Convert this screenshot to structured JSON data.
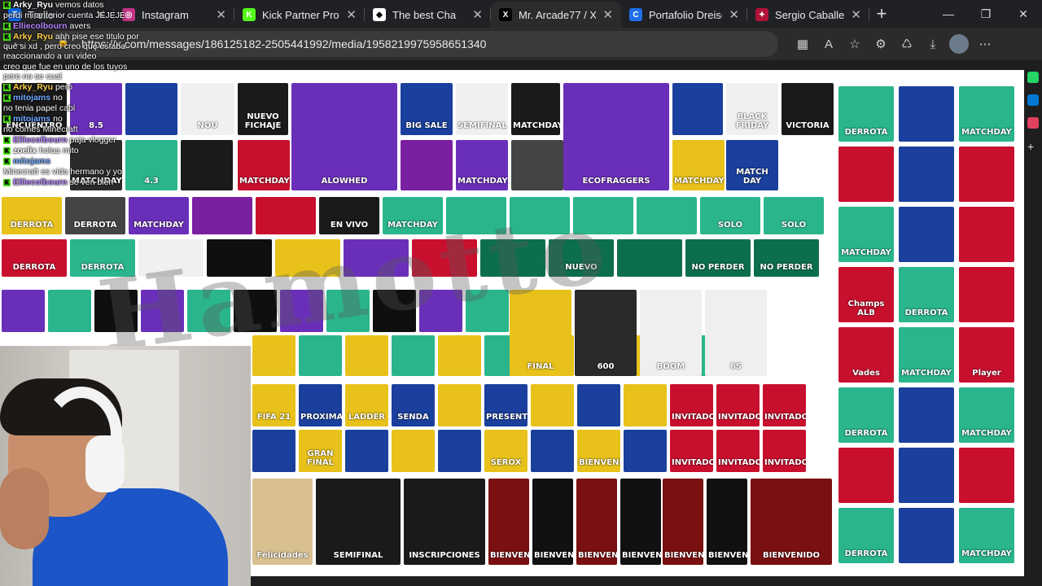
{
  "tabs": [
    {
      "title": "Trello",
      "x": false,
      "color": "#0c66e4",
      "glyph": "T",
      "active": false
    },
    {
      "title": "Instagram",
      "color": "#c13584",
      "glyph": "◎",
      "active": false
    },
    {
      "title": "Kick Partner Progr",
      "color": "#53fc18",
      "glyph": "K",
      "active": false
    },
    {
      "title": "The best Cha",
      "color": "#ffffff",
      "glyph": "◆",
      "active": false
    },
    {
      "title": "Mr. Arcade77 / X",
      "color": "#000000",
      "glyph": "X",
      "active": true
    },
    {
      "title": "Portafolio Dreisen",
      "color": "#1e6fe8",
      "glyph": "C",
      "active": false
    },
    {
      "title": "Sergio Caballero |",
      "color": "#b0123a",
      "glyph": "✦",
      "active": false
    }
  ],
  "window_controls": {
    "minimize": "—",
    "restore": "❐",
    "close": "✕"
  },
  "address_bar": {
    "url": "https://x.com/messages/186125182-2505441992/media/1958219975958651340"
  },
  "chat": [
    {
      "user": "Arky_Ryu",
      "text": "vemos datos",
      "color": "#ffffff"
    },
    {
      "user": "",
      "text": "perdi mi anterior cuenta JEJEJE",
      "color": "#ffffff"
    },
    {
      "user": "Elliecolbourn",
      "text": "avers",
      "color": "#b583ff"
    },
    {
      "user": "Arky_Ryu",
      "text": "ahh pise ese titulo por qué si xd , pero creo que estaba reaccionando a un video",
      "color": "#ffd24a"
    },
    {
      "user": "",
      "text": "creo que fue en uno de los tuyos pero no se cual",
      "color": "#ffffff"
    },
    {
      "user": "Arky_Ryu",
      "text": "pero",
      "color": "#ffd24a"
    },
    {
      "user": "mitojams",
      "text": "no",
      "color": "#6fa8ff"
    },
    {
      "user": "",
      "text": "no tenia papel cabl",
      "color": "#ffffff"
    },
    {
      "user": "mitojams",
      "text": "no",
      "color": "#6fa8ff"
    },
    {
      "user": "",
      "text": "no comes Minecraft",
      "color": "#ffffff"
    },
    {
      "user": "Elliecolbourn",
      "text": "paja vlogger",
      "color": "#b583ff"
    },
    {
      "user": "zoelix",
      "text": "holaa mito",
      "color": "#ffffff"
    },
    {
      "user": "mitojams",
      "text": "",
      "color": "#6fa8ff"
    },
    {
      "user": "",
      "text": "Minecraft es vida hermano y yo",
      "color": "#ffffff"
    },
    {
      "user": "Elliecolbourn",
      "text": "se ven bien",
      "color": "#b583ff"
    }
  ],
  "thumbs": {
    "row1": [
      "ENCUENTRO",
      "8.5",
      "",
      "NOU",
      "NUEVO FICHAJE",
      "ALOWHED",
      "BIG SALE",
      "SEMIFINAL",
      "MATCHDAY",
      "ECOFRAGGERS",
      "",
      "BLACK FRIDAY",
      "VICTORIA"
    ],
    "row2": [
      "MATCHDAY",
      "4.3",
      "",
      "MATCHDAY",
      "",
      "MATCHDAY",
      "",
      "MATCHDAY",
      "MATCH DAY"
    ],
    "row3": [
      "DERROTA",
      "DERROTA",
      "MATCHDAY",
      "",
      "",
      "EN VIVO",
      "MATCHDAY",
      "",
      "",
      "",
      "",
      "SOLO",
      "SOLO"
    ],
    "row4": [
      "DERROTA",
      "DERROTA",
      "",
      "",
      "",
      "",
      "",
      "",
      "NUEVO",
      "",
      "NO PERDER",
      "NO PERDER"
    ],
    "right_col": [
      "DERROTA",
      "",
      "MATCHDAY",
      "",
      "",
      "",
      "MATCHDAY",
      "",
      "",
      "Champs ALB",
      "DERROTA",
      "",
      "Vades",
      "MATCHDAY",
      "Player",
      "DERROTA",
      "",
      "MATCHDAY",
      "",
      "",
      "",
      "DERROTA",
      "",
      "MATCHDAY"
    ],
    "lower_a": [
      "FIFA 21",
      "PROXIMAMENTE",
      "LADDER",
      "SENDA",
      "",
      "PRESENTES",
      "",
      "",
      "",
      "INVITADO",
      "INVITADO",
      "INVITADO"
    ],
    "lower_b": [
      "",
      "GRAN FINAL",
      "",
      "",
      "",
      "SEROX",
      "",
      "BIENVENIDOS",
      "",
      "INVITADO",
      "INVITADO",
      "INVITADO"
    ],
    "bottom": [
      "Felicidades",
      "SEMIFINAL",
      "INSCRIPCIONES",
      "BIENVENIDO",
      "BIENVENIDO",
      "BIENVENIDO",
      "BIENVENIDO",
      "BIENVENIDO",
      "BIENVENIDO",
      "BIENVENIDO"
    ],
    "center_feature": [
      "FINAL",
      "600",
      "BOOM",
      "6S"
    ]
  },
  "watermark": "Hamotto",
  "palette": {
    "accent_green": "#53fc18",
    "brand_purple": "#6a2fb8",
    "jersey_yellow": "#e8c21a",
    "red": "#c8102e",
    "blue": "#1a3f9c",
    "teal": "#2ab58c"
  }
}
